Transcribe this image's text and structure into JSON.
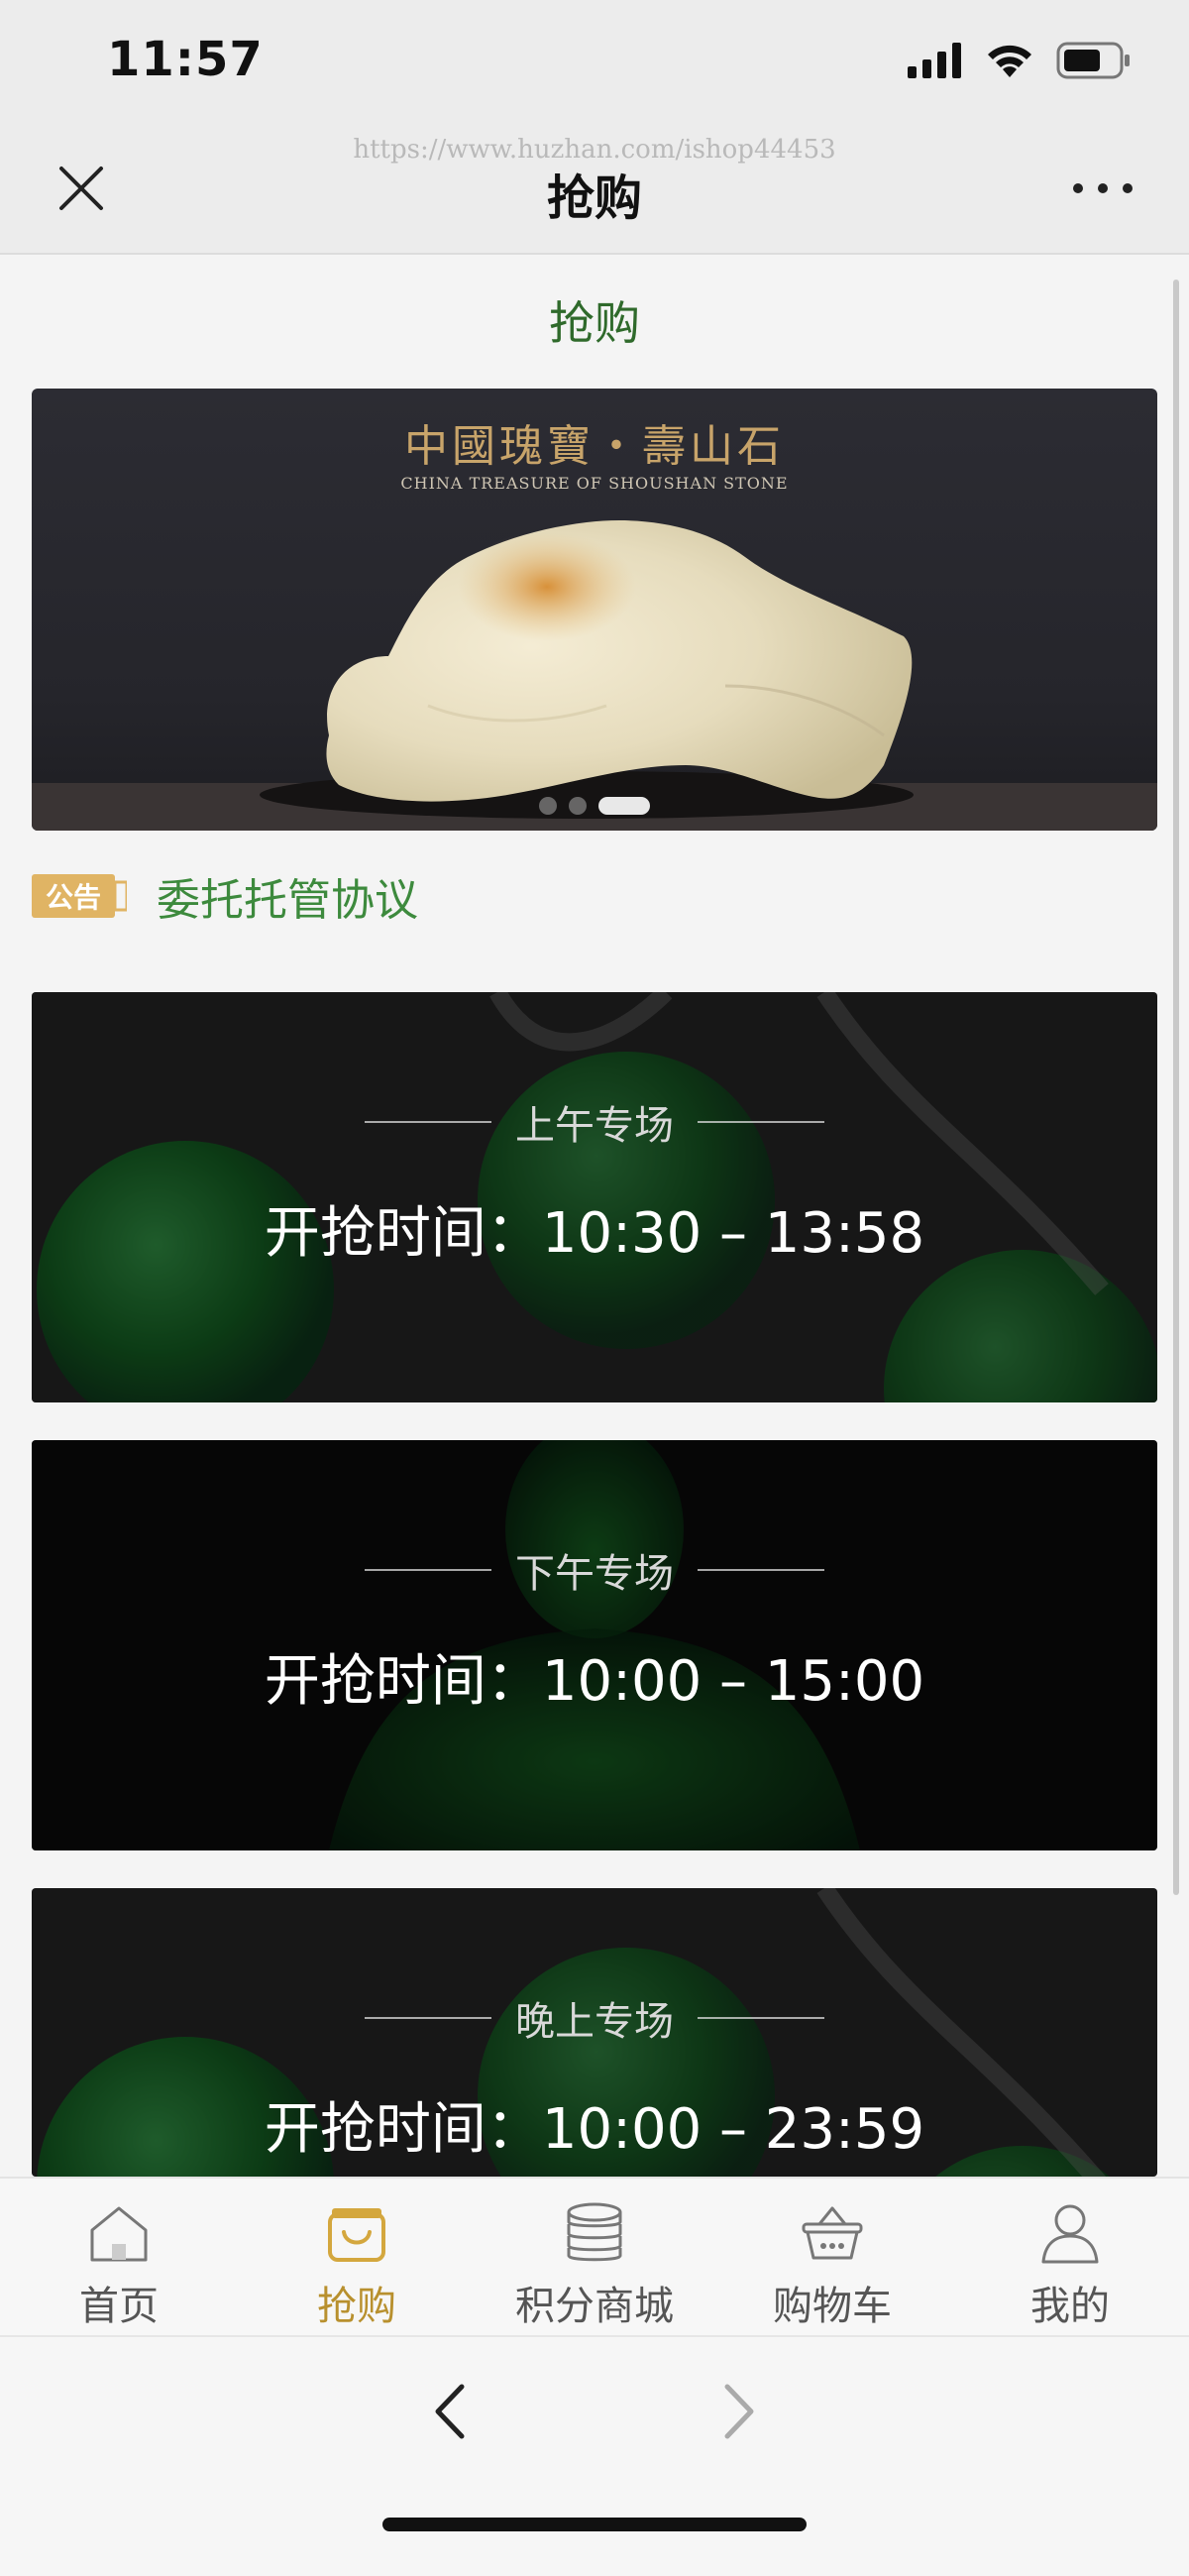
{
  "status_bar": {
    "time": "11:57"
  },
  "nav": {
    "title": "抢购",
    "url_watermark": "https://www.huzhan.com/ishop44453"
  },
  "page": {
    "header": "抢购"
  },
  "banner": {
    "title": "中國瑰寶・壽山石",
    "subtitle": "CHINA TREASURE OF SHOUSHAN STONE",
    "slide_count": 3,
    "active_slide": 3
  },
  "notice": {
    "badge": "公告",
    "text": "委托托管协议"
  },
  "sessions": [
    {
      "label": "上午专场",
      "time": "开抢时间：10:30 – 13:58"
    },
    {
      "label": "下午专场",
      "time": "开抢时间：10:00 – 15:00"
    },
    {
      "label": "晚上专场",
      "time": "开抢时间：10:00 – 23:59"
    }
  ],
  "tab_bar": {
    "items": [
      {
        "label": "首页",
        "icon": "home-icon",
        "active": false
      },
      {
        "label": "抢购",
        "icon": "shopping-bag-icon",
        "active": true
      },
      {
        "label": "积分商城",
        "icon": "coins-icon",
        "active": false
      },
      {
        "label": "购物车",
        "icon": "basket-icon",
        "active": false
      },
      {
        "label": "我的",
        "icon": "user-icon",
        "active": false
      }
    ],
    "active_color": "#b8902e",
    "inactive_color": "#555555"
  },
  "colors": {
    "header_green": "#2f6a2b",
    "notice_green": "#3d8a3d",
    "badge_gold": "#e0b464"
  }
}
